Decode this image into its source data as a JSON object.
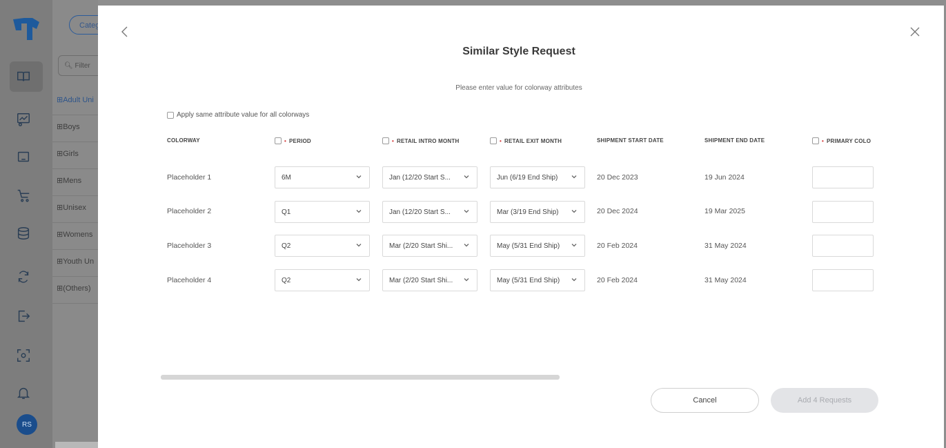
{
  "background": {
    "category_button": "Categ",
    "filter_placeholder": "Filter",
    "tree": [
      {
        "label": "⊞Adult Uni",
        "active": true
      },
      {
        "label": "⊞Boys"
      },
      {
        "label": "⊞Girls"
      },
      {
        "label": "⊞Mens"
      },
      {
        "label": "⊞Unisex"
      },
      {
        "label": "⊞Womens"
      },
      {
        "label": "⊞Youth Un"
      },
      {
        "label": "⊞(Others)"
      }
    ],
    "rail_icons": [
      "book-icon",
      "chart-icon",
      "laptop-icon",
      "cart-icon",
      "database-icon",
      "refresh-icon",
      "logout-icon",
      "scan-icon",
      "bell-icon"
    ],
    "avatar": "RS"
  },
  "modal": {
    "title": "Similar Style Request",
    "subtitle": "Please enter value for colorway attributes",
    "apply_all_label": "Apply same attribute value for all colorways",
    "columns": {
      "colorway": "COLORWAY",
      "period": "PERIOD",
      "retail_intro_month": "RETAIL INTRO MONTH",
      "retail_exit_month": "RETAIL EXIT MONTH",
      "shipment_start_date": "SHIPMENT START DATE",
      "shipment_end_date": "SHIPMENT END DATE",
      "primary_color": "PRIMARY COLO"
    },
    "rows": [
      {
        "colorway": "Placeholder 1",
        "period": "6M",
        "intro": "Jan (12/20 Start S...",
        "exit": "Jun (6/19 End Ship)",
        "ship_start": "20 Dec 2023",
        "ship_end": "19 Jun 2024",
        "primary_color": ""
      },
      {
        "colorway": "Placeholder 2",
        "period": "Q1",
        "intro": "Jan (12/20 Start S...",
        "exit": "Mar (3/19 End Ship)",
        "ship_start": "20 Dec 2024",
        "ship_end": "19 Mar 2025",
        "primary_color": ""
      },
      {
        "colorway": "Placeholder 3",
        "period": "Q2",
        "intro": "Mar (2/20 Start Shi...",
        "exit": "May (5/31 End Ship)",
        "ship_start": "20 Feb 2024",
        "ship_end": "31 May 2024",
        "primary_color": ""
      },
      {
        "colorway": "Placeholder 4",
        "period": "Q2",
        "intro": "Mar (2/20 Start Shi...",
        "exit": "May (5/31 End Ship)",
        "ship_start": "20 Feb 2024",
        "ship_end": "31 May 2024",
        "primary_color": ""
      }
    ],
    "cancel_label": "Cancel",
    "submit_label": "Add 4 Requests",
    "required_marker": "•"
  },
  "colors": {
    "accent": "#1a4d8c",
    "required": "#d23b3b",
    "overlay": "#8e8e8e"
  }
}
